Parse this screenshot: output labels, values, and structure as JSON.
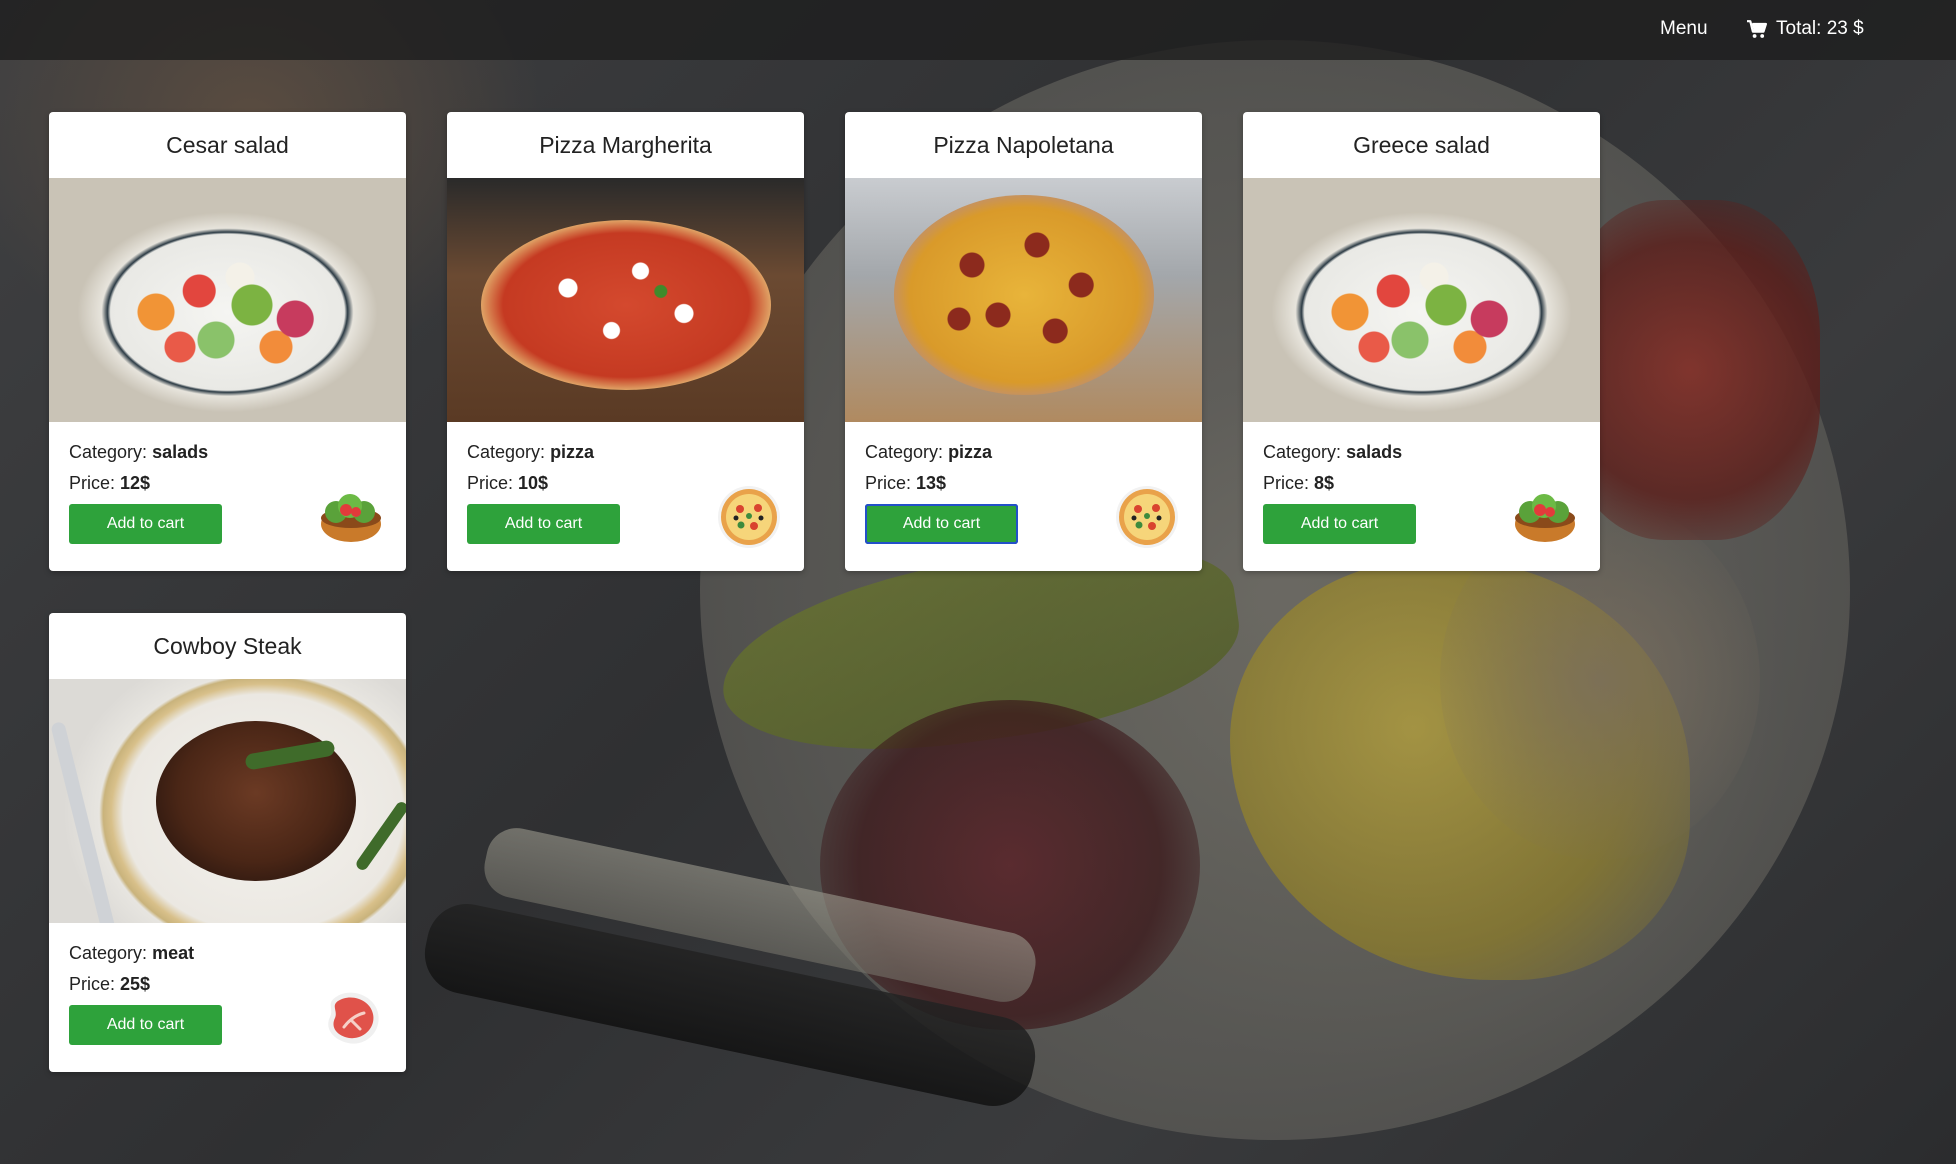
{
  "nav": {
    "menu_label": "Menu",
    "cart_total": "Total: 23 $",
    "cart_icon": "shopping-cart-icon"
  },
  "labels": {
    "category_prefix": "Category:",
    "price_prefix": "Price:",
    "add_to_cart": "Add to cart"
  },
  "products": [
    {
      "title": "Cesar salad",
      "category": "salads",
      "price": "12$",
      "image": "salad-photo",
      "icon": "salad-bowl-icon"
    },
    {
      "title": "Pizza Margherita",
      "category": "pizza",
      "price": "10$",
      "image": "pizza-margherita-photo",
      "icon": "pizza-icon"
    },
    {
      "title": "Pizza Napoletana",
      "category": "pizza",
      "price": "13$",
      "image": "pizza-napoletana-photo",
      "icon": "pizza-icon",
      "focused": true
    },
    {
      "title": "Greece salad",
      "category": "salads",
      "price": "8$",
      "image": "salad-photo",
      "icon": "salad-bowl-icon"
    },
    {
      "title": "Cowboy Steak",
      "category": "meat",
      "price": "25$",
      "image": "steak-photo",
      "icon": "steak-icon"
    }
  ],
  "colors": {
    "button_green": "#2ea23b",
    "focus_outline": "#2350c9",
    "topbar_bg": "rgba(30,30,30,0.82)"
  }
}
